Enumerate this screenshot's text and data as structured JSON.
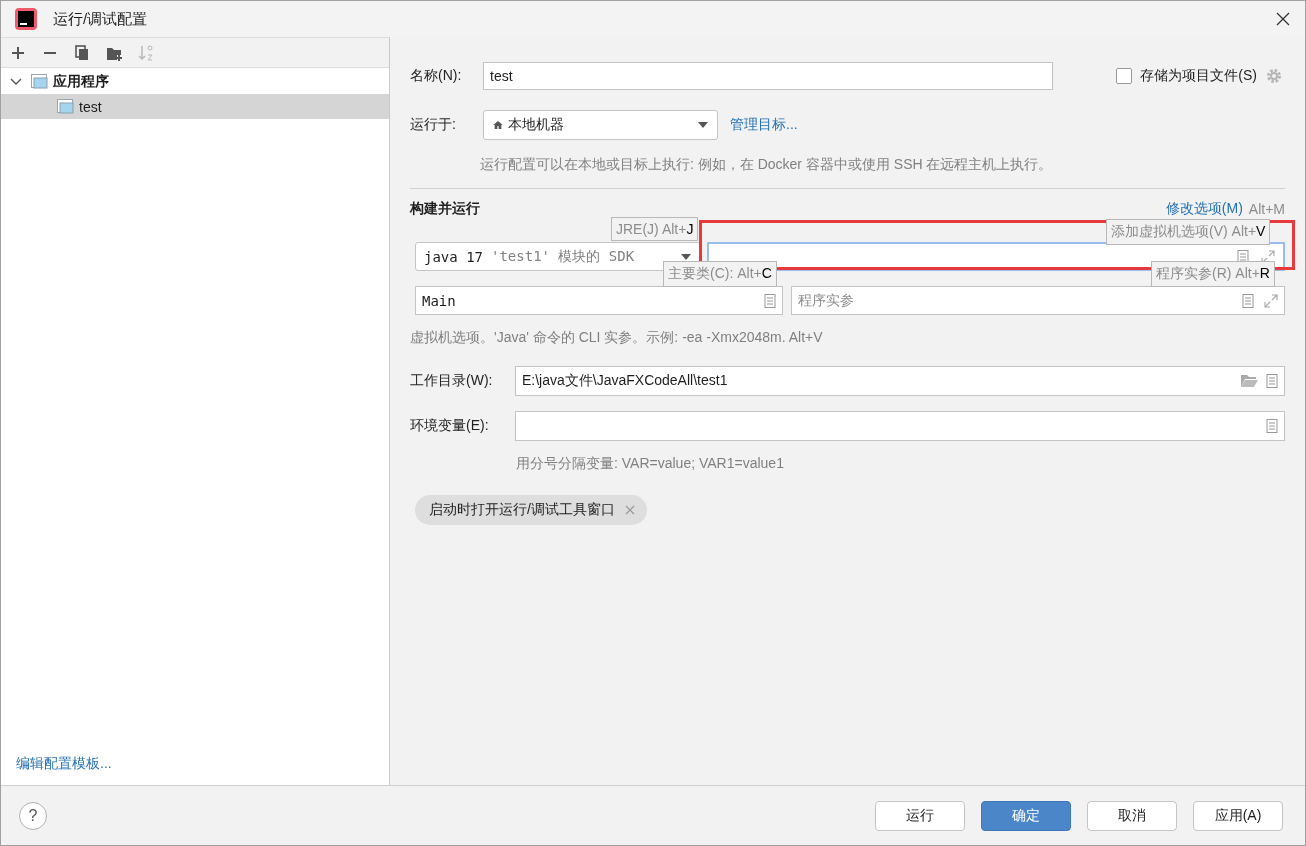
{
  "window": {
    "title": "运行/调试配置"
  },
  "toolbar": [
    {
      "kind": "add",
      "disabled": false
    },
    {
      "kind": "remove",
      "disabled": false
    },
    {
      "kind": "copy",
      "disabled": false
    },
    {
      "kind": "folder",
      "disabled": false
    },
    {
      "kind": "sort",
      "disabled": true
    }
  ],
  "tree": [
    {
      "label": "应用程序",
      "selected": false,
      "expanded": true,
      "children": [
        {
          "label": "test",
          "selected": true
        }
      ]
    }
  ],
  "edit_templates_link": "编辑配置模板...",
  "form": {
    "name": {
      "label": "名称(N):",
      "value": "test"
    },
    "store_as_file": {
      "label": "存储为项目文件(S)",
      "checked": false
    },
    "run_on": {
      "label": "运行于:",
      "value": "本地机器",
      "link": "管理目标..."
    },
    "run_on_hint": "运行配置可以在本地或目标上执行: 例如，在 Docker 容器中或使用 SSH 在远程主机上执行。",
    "section_title": "构建并运行",
    "modify_options": {
      "label": "修改选项(M)",
      "shortcut": "Alt+M"
    },
    "jdk": {
      "value": "java 17",
      "detail": "'test1' 模块的 SDK"
    },
    "vm_options": {
      "focused": true,
      "highlighted": true
    },
    "main_class": {
      "value": "Main"
    },
    "program_args": {
      "placeholder": "程序实参"
    },
    "vm_hint": "虚拟机选项。'Java' 命令的 CLI 实参。示例: -ea -Xmx2048m. Alt+V",
    "working_dir": {
      "label": "工作目录(W):",
      "value": "E:\\java文件\\JavaFXCodeAll\\test1"
    },
    "env_vars": {
      "label": "环境变量(E):"
    },
    "env_hint": "用分号分隔变量: VAR=value; VAR1=value1",
    "chip": {
      "label": "启动时打开运行/调试工具窗口",
      "removable": true
    },
    "tooltips": [
      {
        "kind": "jre",
        "text": "JRE(J) Alt+",
        "key": "J"
      },
      {
        "kind": "vm",
        "text": "添加虚拟机选项(V) Alt+",
        "key": "V"
      },
      {
        "kind": "main",
        "text": "主要类(C): Alt+",
        "key": "C"
      },
      {
        "kind": "args",
        "text": "程序实参(R) Alt+",
        "key": "R"
      }
    ]
  },
  "help_button": "?",
  "buttons": [
    {
      "label": "运行",
      "default": false
    },
    {
      "label": "确定",
      "default": true
    },
    {
      "label": "取消",
      "default": false
    },
    {
      "label": "应用(A)",
      "default": false
    }
  ]
}
